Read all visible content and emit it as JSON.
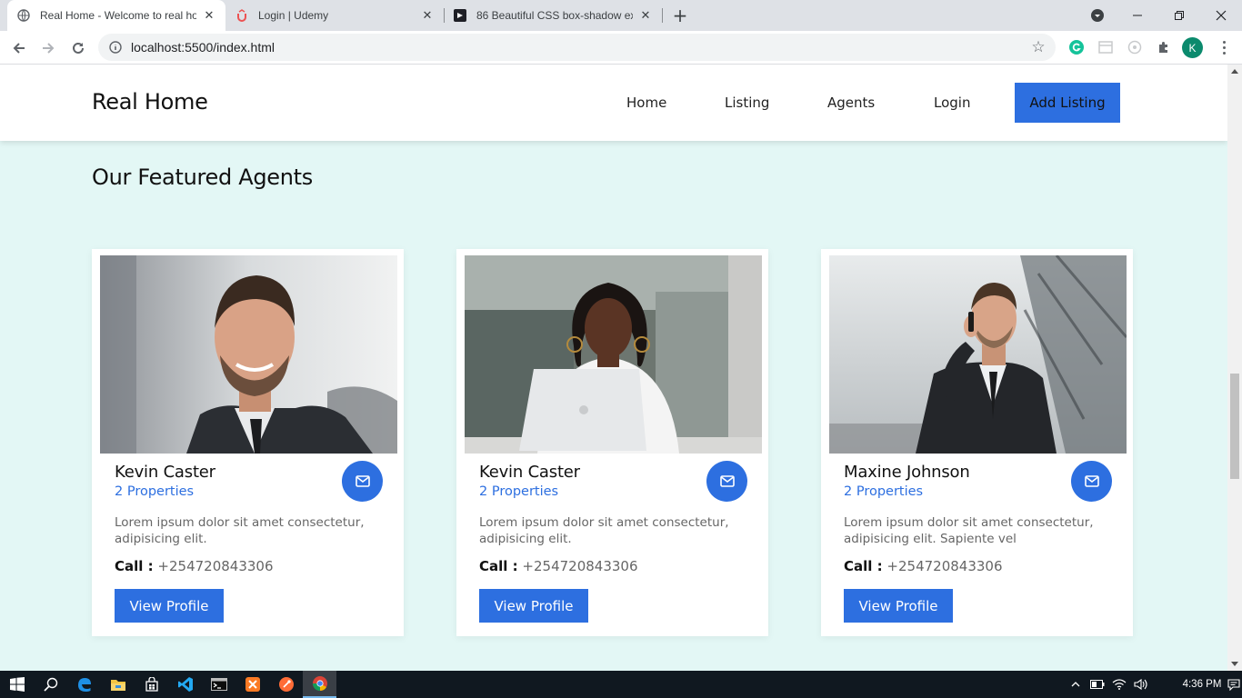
{
  "browser": {
    "tabs": [
      {
        "title": "Real Home - Welcome to real ho",
        "active": true,
        "icon": "globe-icon"
      },
      {
        "title": "Login | Udemy",
        "active": false,
        "icon": "udemy-icon"
      },
      {
        "title": "86 Beautiful CSS box-shadow exa",
        "active": false,
        "icon": "codepen-icon"
      }
    ],
    "url": "localhost:5500/index.html",
    "profile_initial": "K"
  },
  "site": {
    "brand": "Real Home",
    "nav": {
      "home": "Home",
      "listing": "Listing",
      "agents": "Agents",
      "login": "Login",
      "add_listing": "Add Listing"
    },
    "section_title": "Our Featured Agents",
    "agents": [
      {
        "name": "Kevin Caster",
        "properties": "2 Properties",
        "description": "Lorem ipsum dolor sit amet consectetur, adipisicing elit.",
        "call_label": "Call :",
        "phone": "+254720843306",
        "button": "View Profile"
      },
      {
        "name": "Kevin Caster",
        "properties": "2 Properties",
        "description": "Lorem ipsum dolor sit amet consectetur, adipisicing elit.",
        "call_label": "Call :",
        "phone": "+254720843306",
        "button": "View Profile"
      },
      {
        "name": "Maxine Johnson",
        "properties": "2 Properties",
        "description": "Lorem ipsum dolor sit amet consectetur, adipisicing elit. Sapiente vel",
        "call_label": "Call :",
        "phone": "+254720843306",
        "button": "View Profile"
      }
    ]
  },
  "taskbar": {
    "time": "4:36 PM"
  },
  "colors": {
    "accent": "#2d6fe0",
    "page_bg": "#e3f7f5",
    "taskbar": "#101820"
  }
}
